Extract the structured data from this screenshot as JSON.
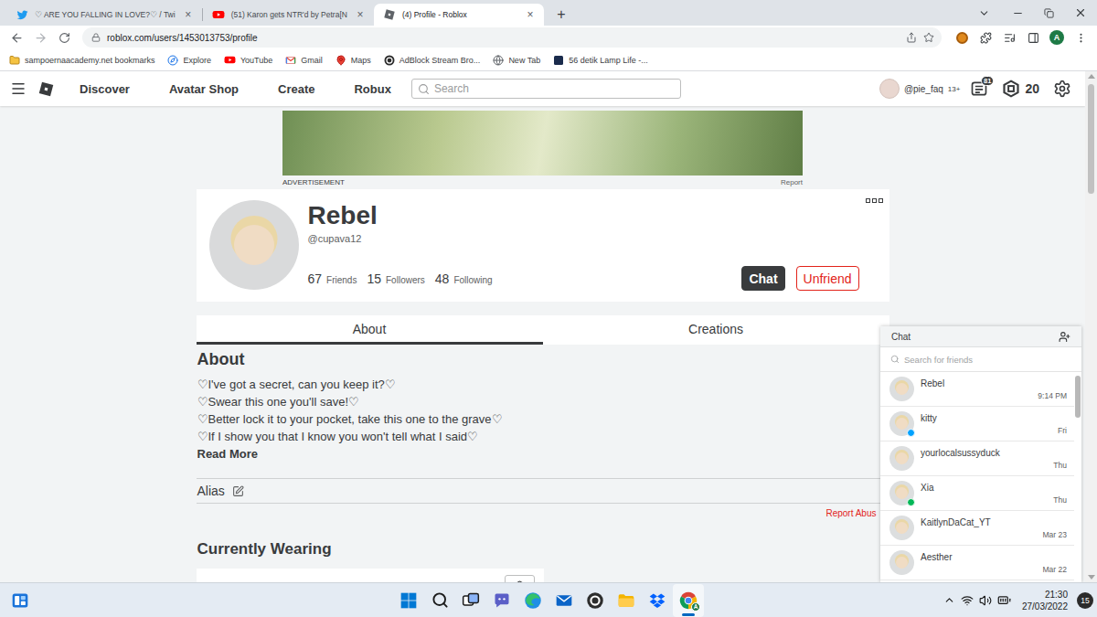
{
  "browser": {
    "tabs": [
      {
        "title": "♡ ARE YOU FALLING IN LOVE?♡ / Twi",
        "kind": "twitter",
        "close": "×",
        "selected": false
      },
      {
        "title": "(51) Karon gets NTR'd by Petra[N",
        "kind": "youtube",
        "close": "×",
        "selected": false
      },
      {
        "title": "(4) Profile - Roblox",
        "kind": "roblox",
        "close": "×",
        "selected": true
      }
    ],
    "new_tab": "+",
    "address": "roblox.com/users/1453013753/profile",
    "profile_initial": "A",
    "bookmarks": [
      {
        "label": "sampoernaacademy.net bookmarks",
        "kind": "folder"
      },
      {
        "label": "Explore",
        "kind": "explore"
      },
      {
        "label": "YouTube",
        "kind": "youtube"
      },
      {
        "label": "Gmail",
        "kind": "gmail"
      },
      {
        "label": "Maps",
        "kind": "maps"
      },
      {
        "label": "AdBlock Stream Bro...",
        "kind": "adblock"
      },
      {
        "label": "New Tab",
        "kind": "newtab"
      },
      {
        "label": "56 detik Lamp Life -...",
        "kind": "page"
      }
    ]
  },
  "site_header": {
    "nav": [
      "Discover",
      "Avatar Shop",
      "Create",
      "Robux"
    ],
    "search_placeholder": "Search",
    "username": "@pie_faq",
    "age_badge": "13+",
    "notifications": "81",
    "robux": "20"
  },
  "ad": {
    "label": "ADVERTISEMENT",
    "report": "Report"
  },
  "profile": {
    "display_name": "Rebel",
    "username": "@cupava12",
    "stats": [
      {
        "count": "67",
        "label": "Friends"
      },
      {
        "count": "15",
        "label": "Followers"
      },
      {
        "count": "48",
        "label": "Following"
      }
    ],
    "chat_button": "Chat",
    "unfriend_button": "Unfriend"
  },
  "tabs": [
    {
      "label": "About",
      "selected": true
    },
    {
      "label": "Creations",
      "selected": false
    }
  ],
  "about": {
    "heading": "About",
    "lines": [
      "♡I've got a secret, can you keep it?♡",
      "♡Swear this one you'll save!♡",
      "♡Better lock it to your pocket, take this one to the grave♡",
      "♡If I show you that I know you won't tell what I said♡"
    ],
    "read_more": "Read More",
    "alias_label": "Alias",
    "report_abuse": "Report Abus"
  },
  "currently_wearing": {
    "heading": "Currently Wearing"
  },
  "chat": {
    "title": "Chat",
    "search_placeholder": "Search for friends",
    "friends": [
      {
        "name": "Rebel",
        "time": "9:14 PM",
        "online": false
      },
      {
        "name": "kitty",
        "time": "Fri",
        "online": true,
        "color": "#00a2ff"
      },
      {
        "name": "yourlocalsussyduck",
        "time": "Thu",
        "online": false
      },
      {
        "name": "Xia",
        "time": "Thu",
        "online": true,
        "color": "#02b757"
      },
      {
        "name": "KaitlynDaCat_YT",
        "time": "Mar 23",
        "online": false
      },
      {
        "name": "Aesther",
        "time": "Mar 22",
        "online": false
      }
    ]
  },
  "taskbar": {
    "apps": [
      {
        "kind": "start",
        "selected": false
      },
      {
        "kind": "search",
        "selected": false
      },
      {
        "kind": "taskview",
        "selected": false
      },
      {
        "kind": "teams",
        "selected": false
      },
      {
        "kind": "edge",
        "selected": false
      },
      {
        "kind": "mail",
        "selected": false
      },
      {
        "kind": "ring",
        "selected": false
      },
      {
        "kind": "explorer",
        "selected": false
      },
      {
        "kind": "dropbox",
        "selected": false
      },
      {
        "kind": "chrome",
        "selected": true,
        "badge": "A"
      }
    ],
    "time": "21:30",
    "date": "27/03/2022",
    "notifications": "15"
  }
}
